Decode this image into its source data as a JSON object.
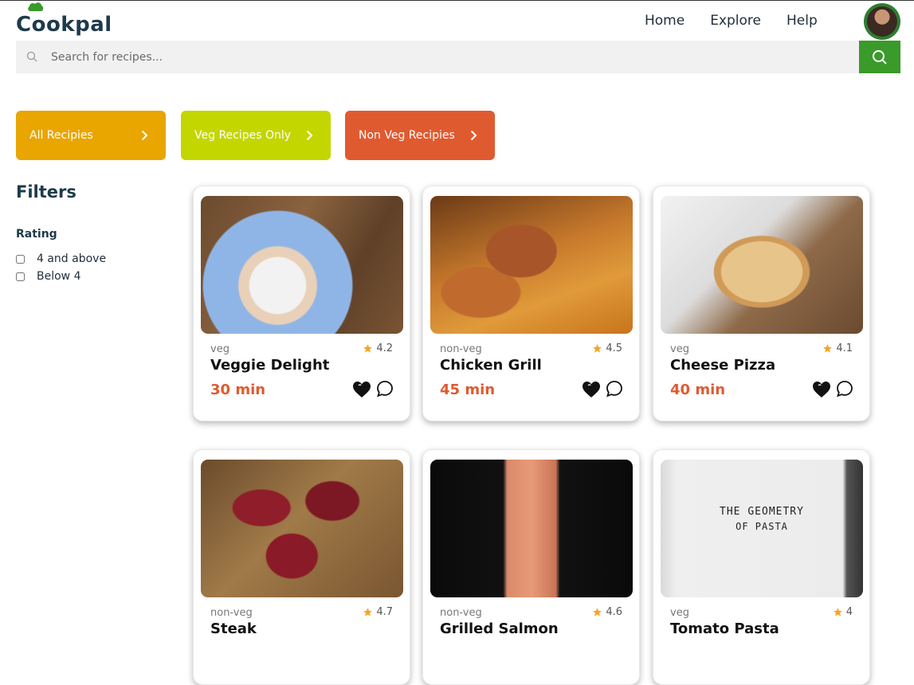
{
  "app": {
    "name": "Cookpal"
  },
  "nav": {
    "home": "Home",
    "explore": "Explore",
    "help": "Help"
  },
  "search": {
    "placeholder": "Search for recipes...",
    "value": ""
  },
  "categories": [
    {
      "label": "All Recipies",
      "color": "#e9a500"
    },
    {
      "label": "Veg Recipes Only",
      "color": "#c4d600"
    },
    {
      "label": "Non Veg Recipies",
      "color": "#e05a30"
    }
  ],
  "filters": {
    "title": "Filters",
    "rating": {
      "title": "Rating",
      "options": [
        "4 and above",
        "Below 4"
      ]
    }
  },
  "recipes": [
    {
      "tag": "veg",
      "rating": "4.2",
      "title": "Veggie Delight",
      "time": "30 min"
    },
    {
      "tag": "non-veg",
      "rating": "4.5",
      "title": "Chicken Grill",
      "time": "45 min"
    },
    {
      "tag": "veg",
      "rating": "4.1",
      "title": "Cheese Pizza",
      "time": "40 min"
    },
    {
      "tag": "non-veg",
      "rating": "4.7",
      "title": "Steak",
      "time": ""
    },
    {
      "tag": "non-veg",
      "rating": "4.6",
      "title": "Grilled Salmon",
      "time": ""
    },
    {
      "tag": "veg",
      "rating": "4",
      "title": "Tomato Pasta",
      "time": ""
    }
  ],
  "pasta_book": {
    "line1": "THE GEOMETRY",
    "line2": "OF PASTA"
  },
  "colors": {
    "accent_green": "#3a9a2a",
    "time_orange": "#e05a30",
    "star": "#f5a623"
  }
}
